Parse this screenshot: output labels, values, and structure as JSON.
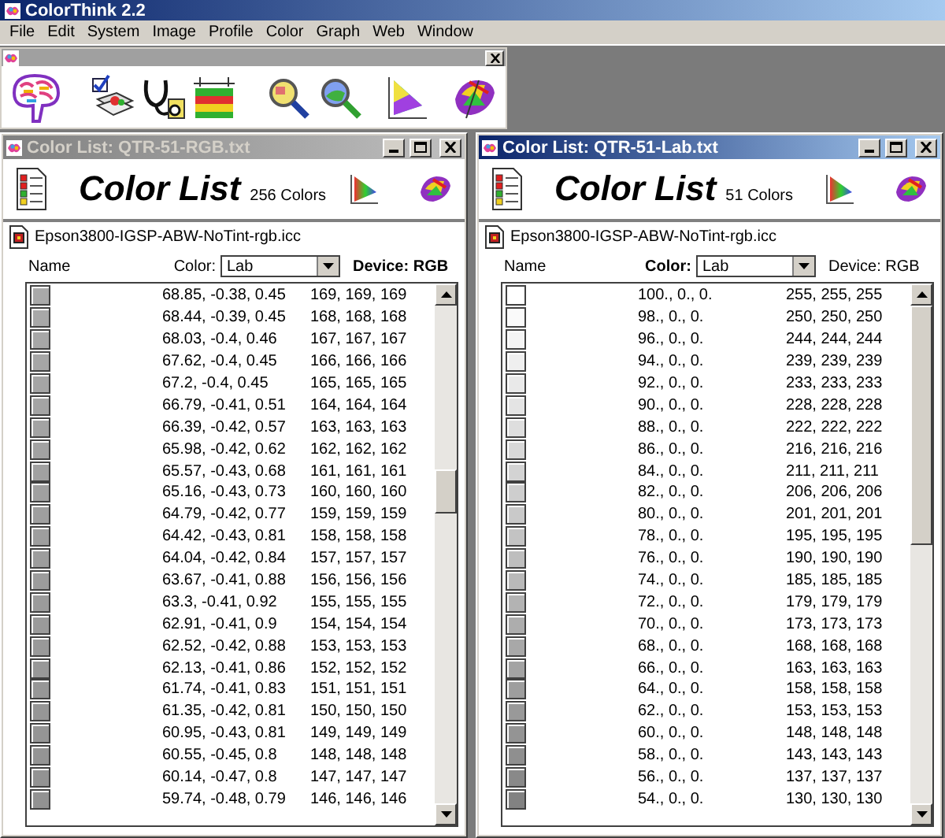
{
  "app": {
    "title": "ColorThink 2.2"
  },
  "menu": [
    "File",
    "Edit",
    "System",
    "Image",
    "Profile",
    "Color",
    "Graph",
    "Web",
    "Window"
  ],
  "windows": [
    {
      "title": "Color List: QTR-51-RGB.txt",
      "active": false,
      "heading": "Color List",
      "count": "256 Colors",
      "profile": "Epson3800-IGSP-ABW-NoTint-rgb.icc",
      "name_label": "Name",
      "color_label": {
        "text": "Color:",
        "bold": false
      },
      "color_select": "Lab",
      "device_label": {
        "text": "Device: RGB",
        "bold": true
      },
      "rows": [
        {
          "lab": "68.85, -0.38, 0.45",
          "rgb": "169, 169, 169",
          "color": "#a9a9a9"
        },
        {
          "lab": "68.44, -0.39, 0.45",
          "rgb": "168, 168, 168",
          "color": "#a8a8a8"
        },
        {
          "lab": "68.03, -0.4, 0.46",
          "rgb": "167, 167, 167",
          "color": "#a7a7a7"
        },
        {
          "lab": "67.62, -0.4, 0.45",
          "rgb": "166, 166, 166",
          "color": "#a6a6a6"
        },
        {
          "lab": "67.2, -0.4, 0.45",
          "rgb": "165, 165, 165",
          "color": "#a5a5a5"
        },
        {
          "lab": "66.79, -0.41, 0.51",
          "rgb": "164, 164, 164",
          "color": "#a4a4a4"
        },
        {
          "lab": "66.39, -0.42, 0.57",
          "rgb": "163, 163, 163",
          "color": "#a3a3a3"
        },
        {
          "lab": "65.98, -0.42, 0.62",
          "rgb": "162, 162, 162",
          "color": "#a2a2a2"
        },
        {
          "lab": "65.57, -0.43, 0.68",
          "rgb": "161, 161, 161",
          "color": "#a1a1a1"
        },
        {
          "lab": "65.16, -0.43, 0.73",
          "rgb": "160, 160, 160",
          "color": "#a0a0a0"
        },
        {
          "lab": "64.79, -0.42, 0.77",
          "rgb": "159, 159, 159",
          "color": "#9f9f9f"
        },
        {
          "lab": "64.42, -0.43, 0.81",
          "rgb": "158, 158, 158",
          "color": "#9e9e9e"
        },
        {
          "lab": "64.04, -0.42, 0.84",
          "rgb": "157, 157, 157",
          "color": "#9d9d9d"
        },
        {
          "lab": "63.67, -0.41, 0.88",
          "rgb": "156, 156, 156",
          "color": "#9c9c9c"
        },
        {
          "lab": "63.3, -0.41, 0.92",
          "rgb": "155, 155, 155",
          "color": "#9b9b9b"
        },
        {
          "lab": "62.91, -0.41, 0.9",
          "rgb": "154, 154, 154",
          "color": "#9a9a9a"
        },
        {
          "lab": "62.52, -0.42, 0.88",
          "rgb": "153, 153, 153",
          "color": "#999999"
        },
        {
          "lab": "62.13, -0.41, 0.86",
          "rgb": "152, 152, 152",
          "color": "#989898"
        },
        {
          "lab": "61.74, -0.41, 0.83",
          "rgb": "151, 151, 151",
          "color": "#979797"
        },
        {
          "lab": "61.35, -0.42, 0.81",
          "rgb": "150, 150, 150",
          "color": "#969696"
        },
        {
          "lab": "60.95, -0.43, 0.81",
          "rgb": "149, 149, 149",
          "color": "#959595"
        },
        {
          "lab": "60.55, -0.45, 0.8",
          "rgb": "148, 148, 148",
          "color": "#949494"
        },
        {
          "lab": "60.14, -0.47, 0.8",
          "rgb": "147, 147, 147",
          "color": "#939393"
        },
        {
          "lab": "59.74, -0.48, 0.79",
          "rgb": "146, 146, 146",
          "color": "#929292"
        }
      ]
    },
    {
      "title": "Color List: QTR-51-Lab.txt",
      "active": true,
      "heading": "Color List",
      "count": "51 Colors",
      "profile": "Epson3800-IGSP-ABW-NoTint-rgb.icc",
      "name_label": "Name",
      "color_label": {
        "text": "Color:",
        "bold": true
      },
      "color_select": "Lab",
      "device_label": {
        "text": "Device: RGB",
        "bold": false
      },
      "rows": [
        {
          "lab": "100., 0., 0.",
          "rgb": "255, 255, 255",
          "color": "#ffffff"
        },
        {
          "lab": "98., 0., 0.",
          "rgb": "250, 250, 250",
          "color": "#fafafa"
        },
        {
          "lab": "96., 0., 0.",
          "rgb": "244, 244, 244",
          "color": "#f4f4f4"
        },
        {
          "lab": "94., 0., 0.",
          "rgb": "239, 239, 239",
          "color": "#efefef"
        },
        {
          "lab": "92., 0., 0.",
          "rgb": "233, 233, 233",
          "color": "#e9e9e9"
        },
        {
          "lab": "90., 0., 0.",
          "rgb": "228, 228, 228",
          "color": "#e4e4e4"
        },
        {
          "lab": "88., 0., 0.",
          "rgb": "222, 222, 222",
          "color": "#dedede"
        },
        {
          "lab": "86., 0., 0.",
          "rgb": "216, 216, 216",
          "color": "#d8d8d8"
        },
        {
          "lab": "84., 0., 0.",
          "rgb": "211, 211, 211",
          "color": "#d3d3d3"
        },
        {
          "lab": "82., 0., 0.",
          "rgb": "206, 206, 206",
          "color": "#cecece"
        },
        {
          "lab": "80., 0., 0.",
          "rgb": "201, 201, 201",
          "color": "#c9c9c9"
        },
        {
          "lab": "78., 0., 0.",
          "rgb": "195, 195, 195",
          "color": "#c3c3c3"
        },
        {
          "lab": "76., 0., 0.",
          "rgb": "190, 190, 190",
          "color": "#bebebe"
        },
        {
          "lab": "74., 0., 0.",
          "rgb": "185, 185, 185",
          "color": "#b9b9b9"
        },
        {
          "lab": "72., 0., 0.",
          "rgb": "179, 179, 179",
          "color": "#b3b3b3"
        },
        {
          "lab": "70., 0., 0.",
          "rgb": "173, 173, 173",
          "color": "#adadad"
        },
        {
          "lab": "68., 0., 0.",
          "rgb": "168, 168, 168",
          "color": "#a8a8a8"
        },
        {
          "lab": "66., 0., 0.",
          "rgb": "163, 163, 163",
          "color": "#a3a3a3"
        },
        {
          "lab": "64., 0., 0.",
          "rgb": "158, 158, 158",
          "color": "#9e9e9e"
        },
        {
          "lab": "62., 0., 0.",
          "rgb": "153, 153, 153",
          "color": "#999999"
        },
        {
          "lab": "60., 0., 0.",
          "rgb": "148, 148, 148",
          "color": "#949494"
        },
        {
          "lab": "58., 0., 0.",
          "rgb": "143, 143, 143",
          "color": "#8f8f8f"
        },
        {
          "lab": "56., 0., 0.",
          "rgb": "137, 137, 137",
          "color": "#898989"
        },
        {
          "lab": "54., 0., 0.",
          "rgb": "130, 130, 130",
          "color": "#828282"
        }
      ]
    }
  ]
}
